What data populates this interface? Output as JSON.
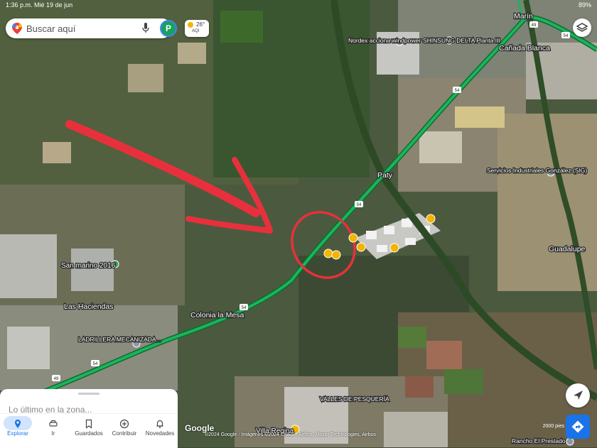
{
  "status_bar": {
    "time": "1:36 p.m.",
    "date": "Mié 19 de jun",
    "battery": "89%"
  },
  "search": {
    "placeholder": "Buscar aquí",
    "avatar_letter": "P"
  },
  "weather": {
    "temp": "26°",
    "aqi": "AQI"
  },
  "places": [
    {
      "name": "Marín"
    },
    {
      "name": "Cañada Blanca"
    },
    {
      "name": "Nordex acciona windpower"
    },
    {
      "name": "SHINSUNG DELTA Planta III"
    },
    {
      "name": "Paty"
    },
    {
      "name": "Servicios Industriales González (SIG)"
    },
    {
      "name": "Guadalupe"
    },
    {
      "name": "San marino 2016"
    },
    {
      "name": "Las Haciendas"
    },
    {
      "name": "Colonia la Mesa"
    },
    {
      "name": "LADRILLERA MECANIZADA..."
    },
    {
      "name": "VALLES DE PESQUERÍA"
    },
    {
      "name": "Villa Regina"
    },
    {
      "name": "Rancho El Prestado"
    }
  ],
  "road_shields": [
    "49",
    "54",
    "54",
    "54",
    "54",
    "49",
    "54"
  ],
  "bottom_sheet": {
    "recent_title": "Lo último en la zona..."
  },
  "tabs": [
    {
      "label": "Explorar",
      "icon": "pin-icon",
      "active": true
    },
    {
      "label": "Ir",
      "icon": "car-icon",
      "active": false
    },
    {
      "label": "Guardados",
      "icon": "bookmark-icon",
      "active": false
    },
    {
      "label": "Contribuir",
      "icon": "plus-circle-icon",
      "active": false
    },
    {
      "label": "Novedades",
      "icon": "bell-icon",
      "active": false
    }
  ],
  "attribution": {
    "logo": "Google",
    "credit": "©2024 Google · Imágenes ©2024 CNES / Airbus, Maxar Technologies, Airbus"
  },
  "scale": {
    "label": "2000 pies"
  },
  "colors": {
    "route": "#1db35a",
    "annotation": "#e8303c",
    "star_marker": "#f4b400",
    "accent": "#1a73e8"
  }
}
